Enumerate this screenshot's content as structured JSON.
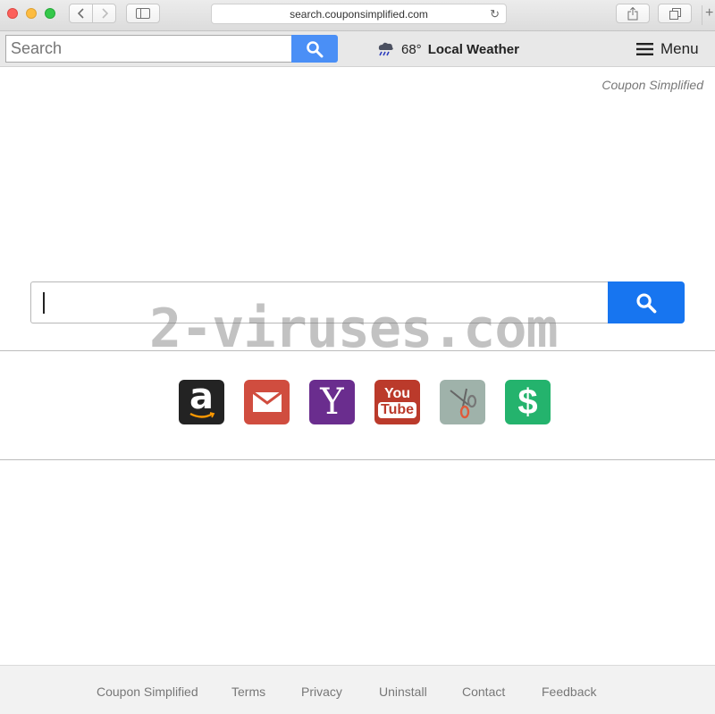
{
  "browser": {
    "url": "search.couponsimplified.com"
  },
  "toolbar": {
    "search_placeholder": "Search",
    "weather_temp": "68°",
    "weather_label": "Local Weather",
    "menu_label": "Menu"
  },
  "brand": {
    "name": "Coupon Simplified"
  },
  "watermark": "2-viruses.com",
  "shortcuts": {
    "youtube_top": "You",
    "youtube_bottom": "Tube"
  },
  "footer": {
    "links": [
      "Coupon Simplified",
      "Terms",
      "Privacy",
      "Uninstall",
      "Contact",
      "Feedback"
    ]
  },
  "colors": {
    "search_button": "#4a8ff6",
    "main_search_button": "#1775f0",
    "amazon": "#232323",
    "gmail": "#d04d3f",
    "yahoo": "#6a2d8e",
    "youtube": "#bb3a2b",
    "coupons": "#9fb2aa",
    "money": "#24b36d"
  }
}
